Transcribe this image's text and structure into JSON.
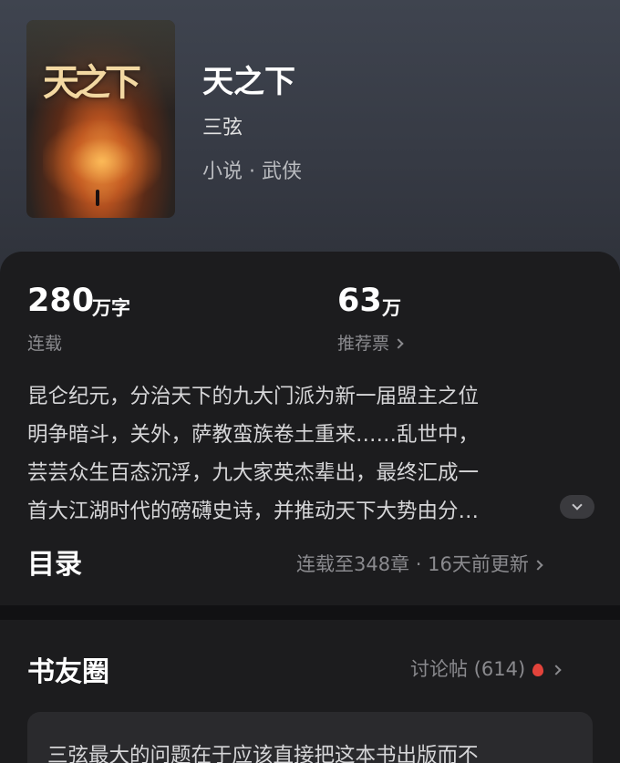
{
  "book": {
    "cover_art_text": "天之下",
    "title": "天之下",
    "author": "三弦",
    "genre": "小说 · 武侠"
  },
  "stats": {
    "words_value": "280",
    "words_unit": "万字",
    "words_label": "连载",
    "votes_value": "63",
    "votes_unit": "万",
    "votes_label": "推荐票"
  },
  "synopsis": {
    "lines": [
      "昆仑纪元，分治天下的九大门派为新一届盟主之位",
      "明争暗斗，关外，萨教蛮族卷土重来……乱世中，",
      "芸芸众生百态沉浮，九大家英杰辈出，最终汇成一",
      "首大江湖时代的磅礴史诗，并推动天下大势由分…"
    ]
  },
  "toc": {
    "title": "目录",
    "status": "连载至348章 · 16天前更新"
  },
  "circle": {
    "title": "书友圈",
    "discuss_label": "讨论帖 (614)",
    "post_preview": "三弦最大的问题在于应该直接把这本书出版而不"
  },
  "icons": {
    "votes_chevron": "chevron-right-icon",
    "expand": "chevron-down-icon",
    "toc_chevron": "chevron-right-icon",
    "hot": "fire-icon",
    "discuss_chevron": "chevron-right-icon"
  },
  "colors": {
    "hot_icon": "#e2433b"
  }
}
